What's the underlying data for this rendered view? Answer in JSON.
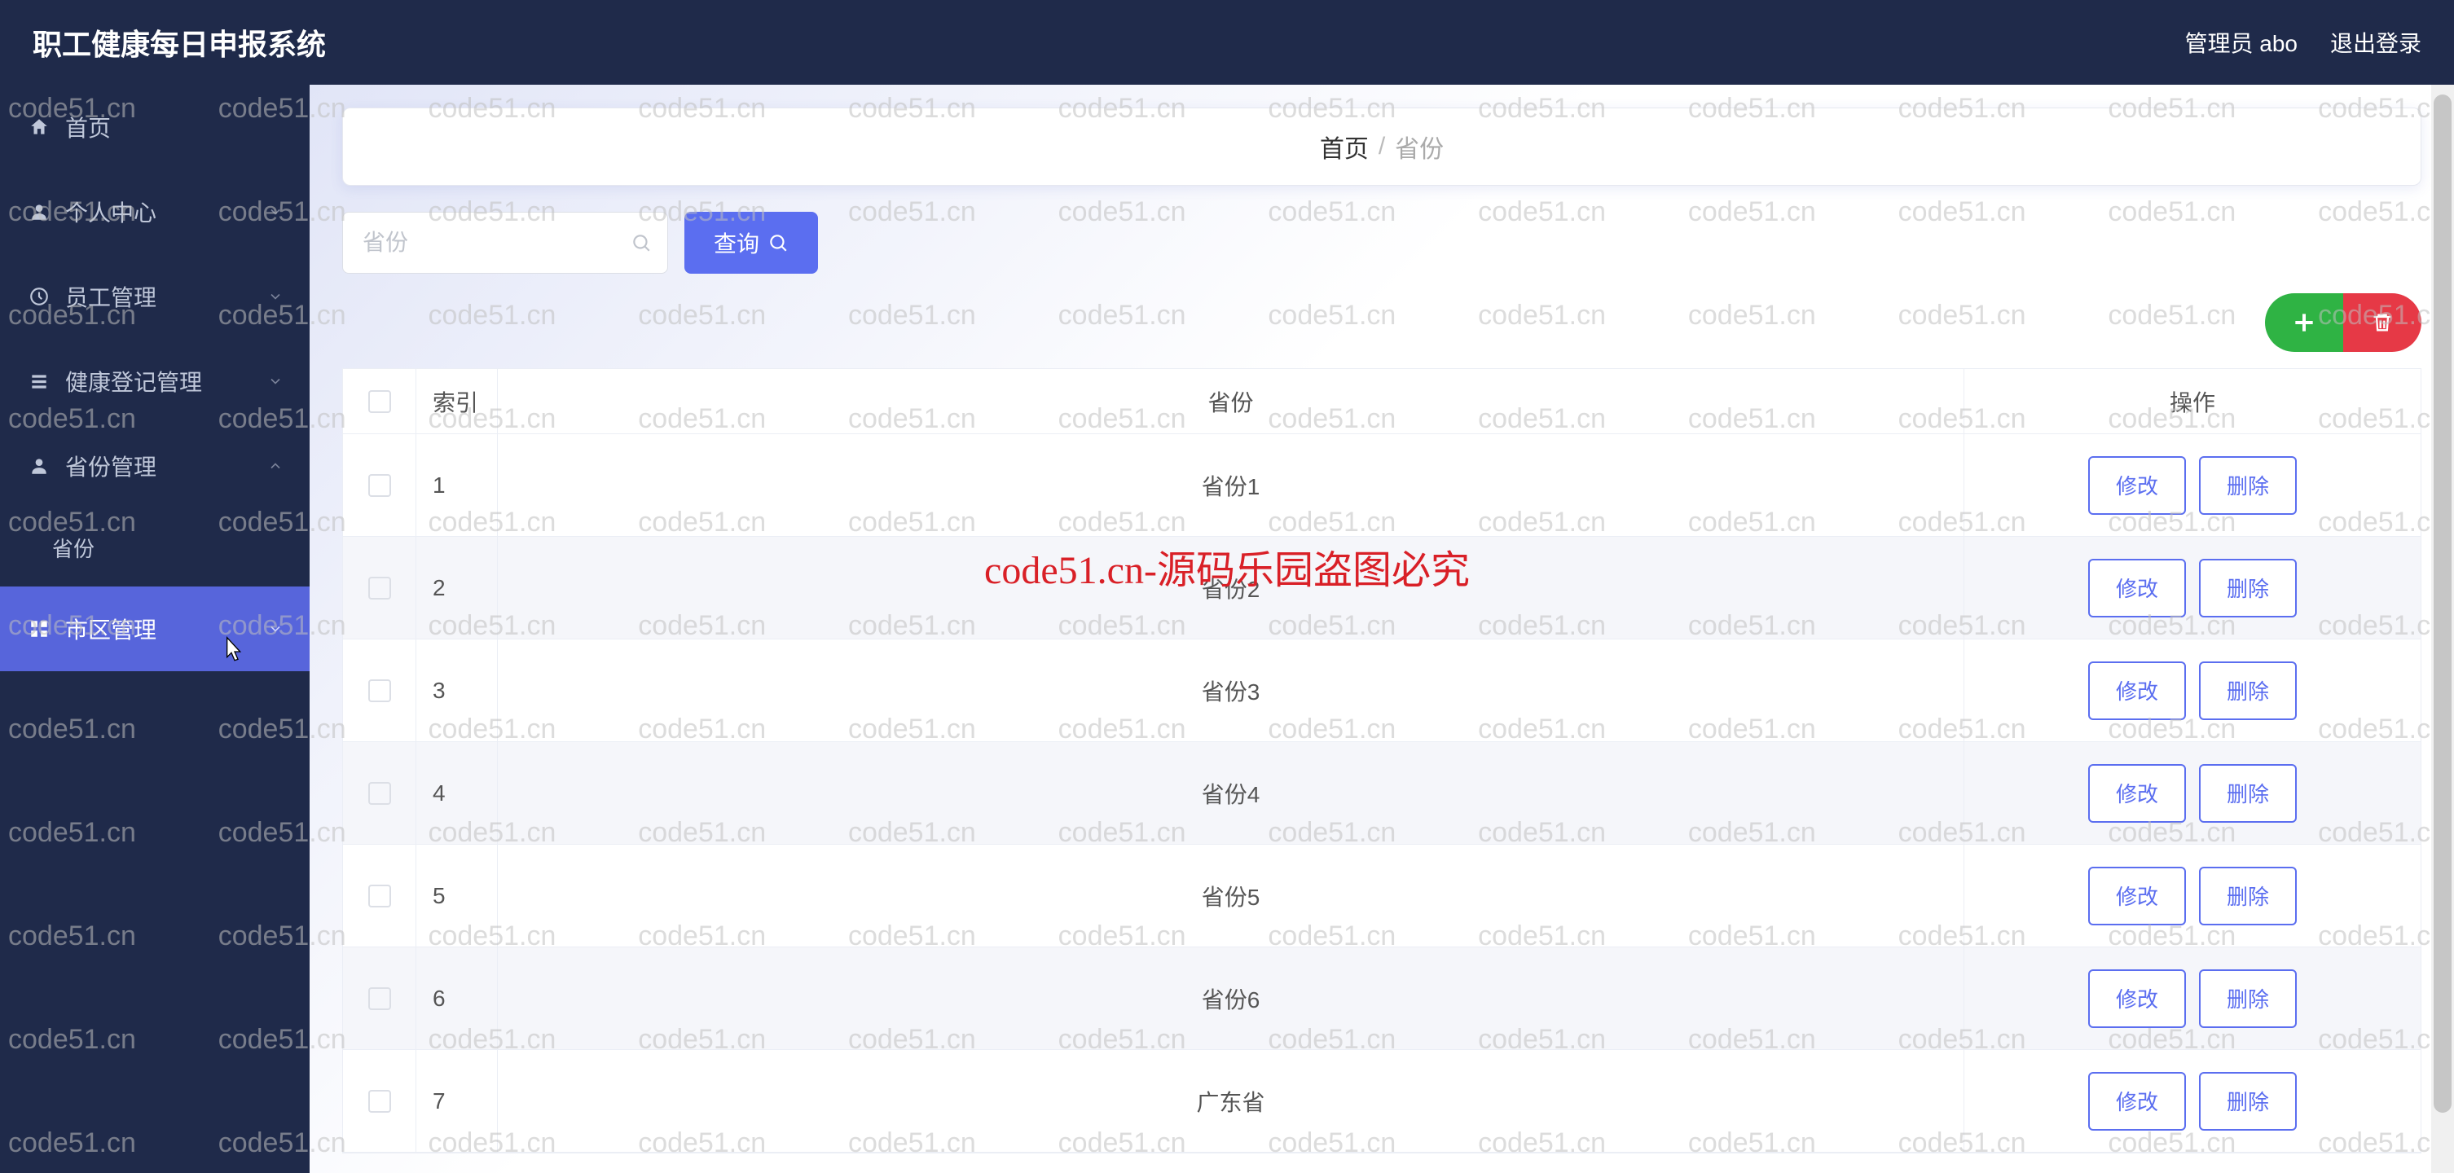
{
  "app_title": "职工健康每日申报系统",
  "header": {
    "user_label": "管理员 abo",
    "logout_label": "退出登录"
  },
  "sidebar": {
    "items": [
      {
        "icon": "home",
        "label": "首页",
        "expandable": false
      },
      {
        "icon": "user",
        "label": "个人中心",
        "expandable": true
      },
      {
        "icon": "clock",
        "label": "员工管理",
        "expandable": true
      },
      {
        "icon": "list",
        "label": "健康登记管理",
        "expandable": true
      },
      {
        "icon": "user",
        "label": "省份管理",
        "expandable": true
      }
    ],
    "sub_province": "省份",
    "district_label": "市区管理"
  },
  "breadcrumb": {
    "home": "首页",
    "current": "省份"
  },
  "search": {
    "placeholder": "省份",
    "query_label": "查询"
  },
  "table": {
    "header": {
      "index": "索引",
      "name": "省份",
      "op": "操作"
    },
    "rows": [
      {
        "index": "1",
        "name": "省份1"
      },
      {
        "index": "2",
        "name": "省份2"
      },
      {
        "index": "3",
        "name": "省份3"
      },
      {
        "index": "4",
        "name": "省份4"
      },
      {
        "index": "5",
        "name": "省份5"
      },
      {
        "index": "6",
        "name": "省份6"
      },
      {
        "index": "7",
        "name": "广东省"
      }
    ],
    "edit_label": "修改",
    "delete_label": "删除"
  },
  "watermark": {
    "text": "code51.cn",
    "center_text": "code51.cn-源码乐园盗图必究"
  }
}
